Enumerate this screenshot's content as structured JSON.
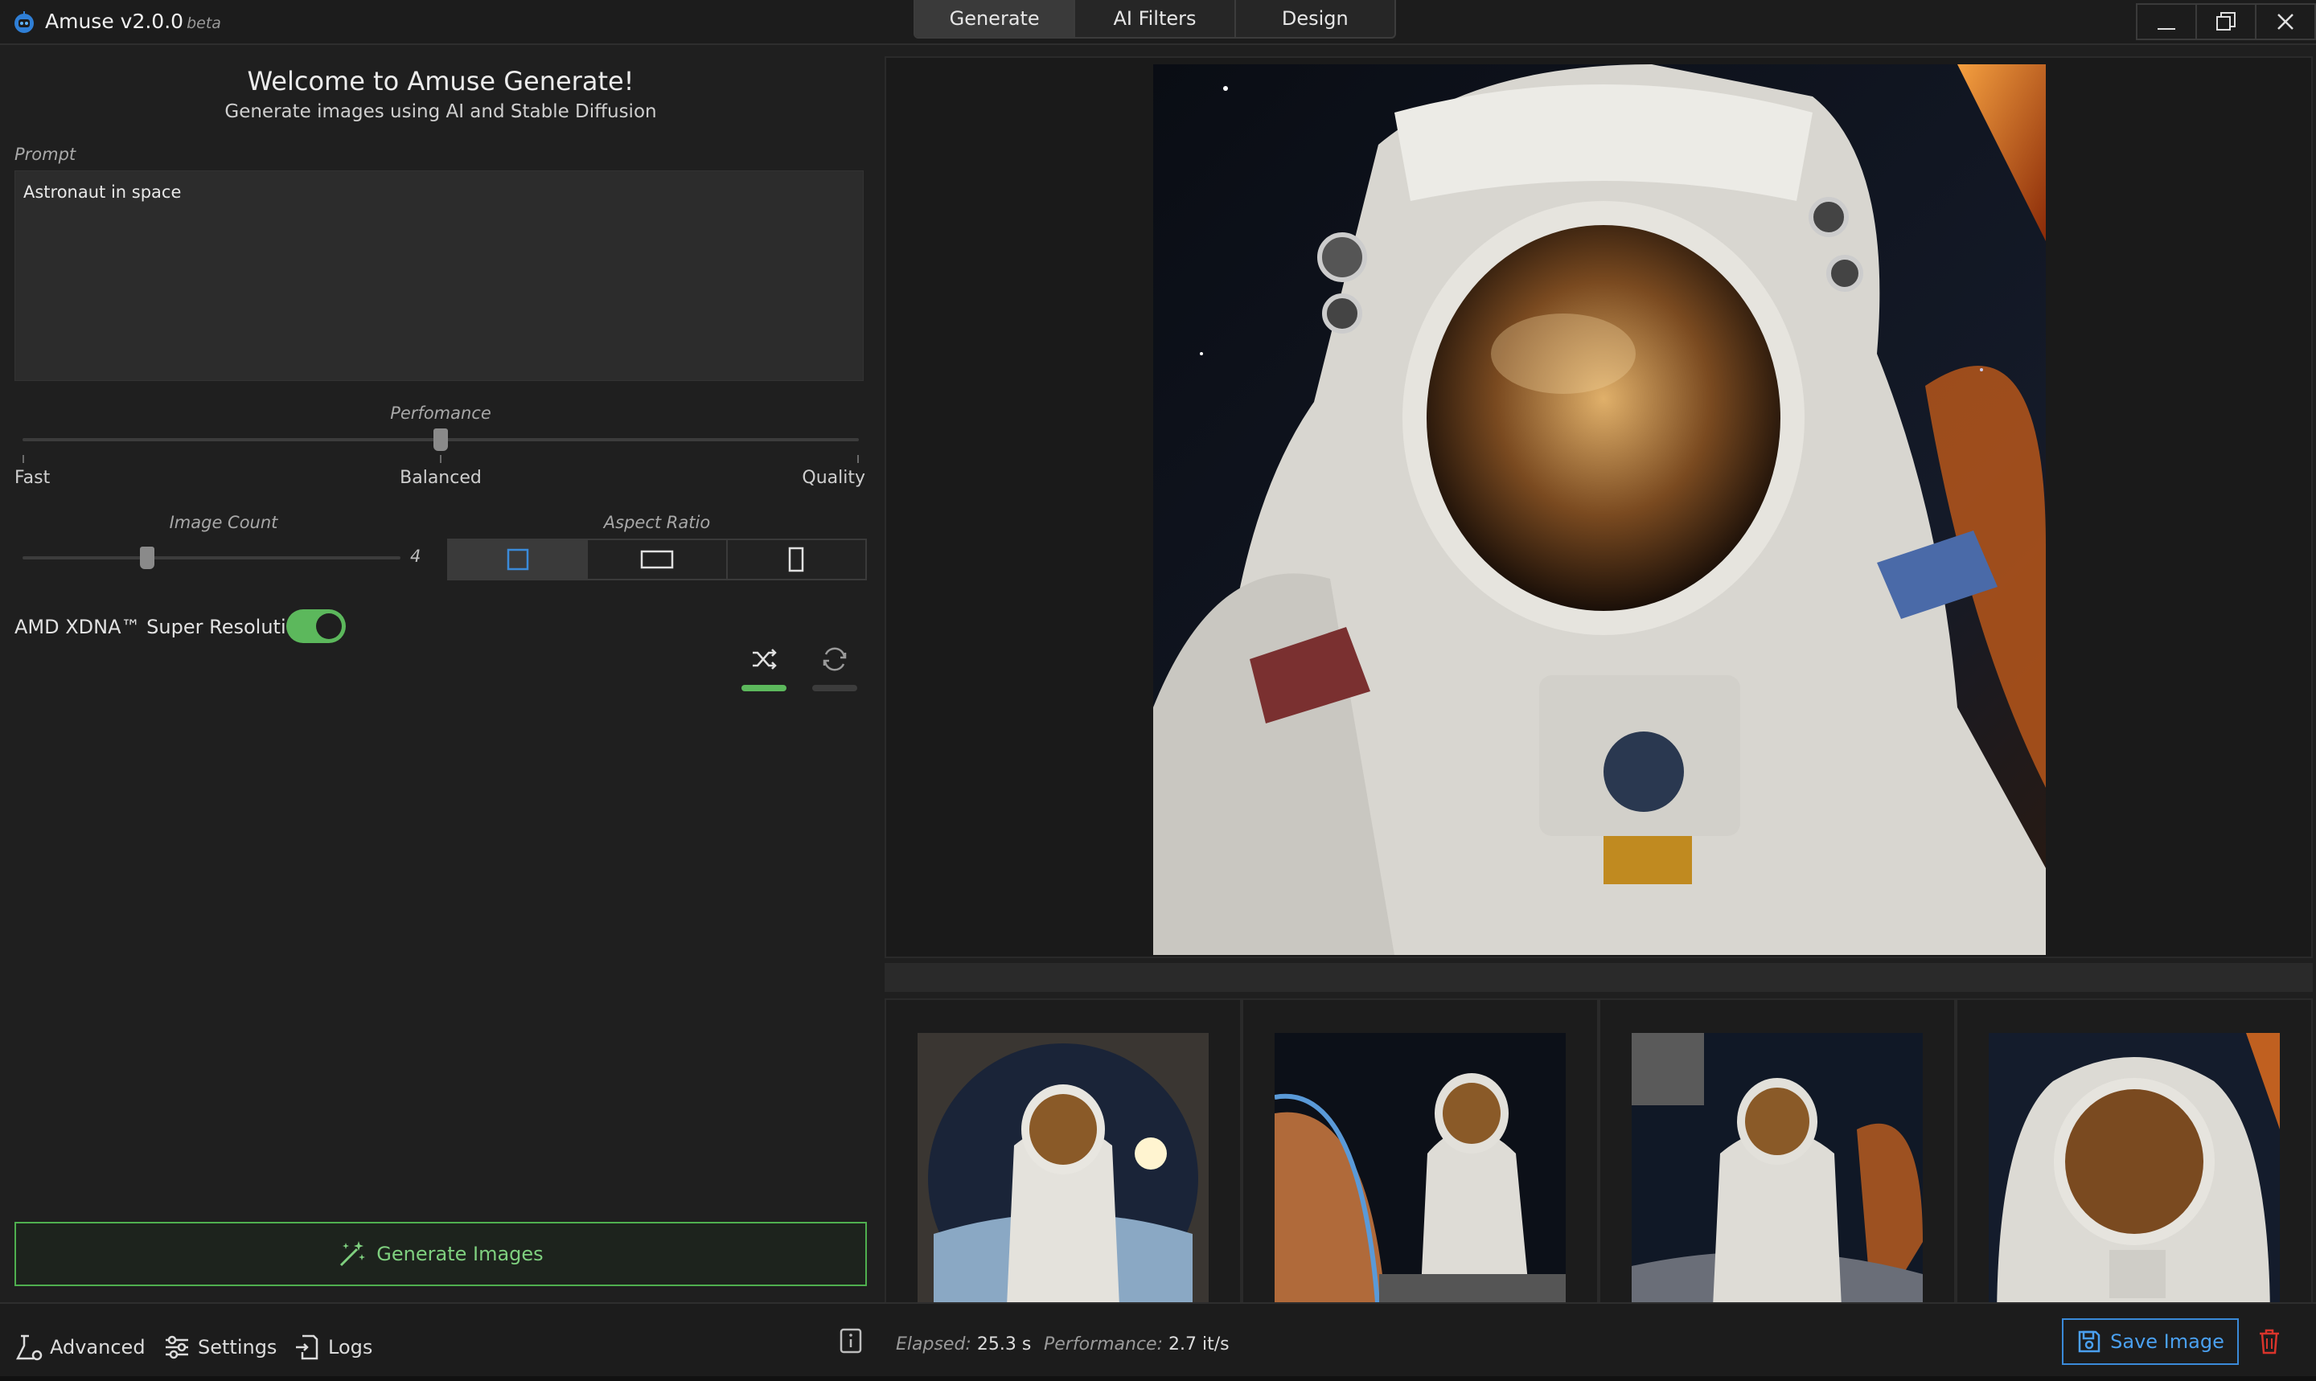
{
  "app": {
    "name": "Amuse v2.0.0",
    "tag": "beta"
  },
  "tabs": [
    {
      "label": "Generate",
      "active": true
    },
    {
      "label": "AI Filters",
      "active": false
    },
    {
      "label": "Design",
      "active": false
    }
  ],
  "welcome": {
    "title": "Welcome to Amuse Generate!",
    "subtitle": "Generate images using AI and Stable Diffusion"
  },
  "prompt": {
    "label": "Prompt",
    "value": "Astronaut in space"
  },
  "performance": {
    "label": "Perfomance",
    "fast": "Fast",
    "balanced": "Balanced",
    "quality": "Quality",
    "level": 0.5
  },
  "image_count": {
    "label": "Image Count",
    "value": "4",
    "level": 0.33
  },
  "aspect_ratio": {
    "label": "Aspect Ratio",
    "options": [
      "square",
      "landscape",
      "portrait"
    ],
    "selected": "square"
  },
  "super_resolution": {
    "label": "AMD XDNA™ Super Resolution",
    "enabled": true
  },
  "generate_button": {
    "label": "Generate Images"
  },
  "statusbar": {
    "advanced": "Advanced",
    "settings": "Settings",
    "logs": "Logs",
    "elapsed_label": "Elapsed:",
    "elapsed_value": "25.3 s",
    "performance_label": "Performance:",
    "performance_value": "2.7 it/s",
    "save_label": "Save Image"
  },
  "colors": {
    "accent_green": "#5cb85c",
    "accent_blue": "#3a8ad9",
    "delete_red": "#d9342b",
    "background": "#1f1f1f"
  }
}
